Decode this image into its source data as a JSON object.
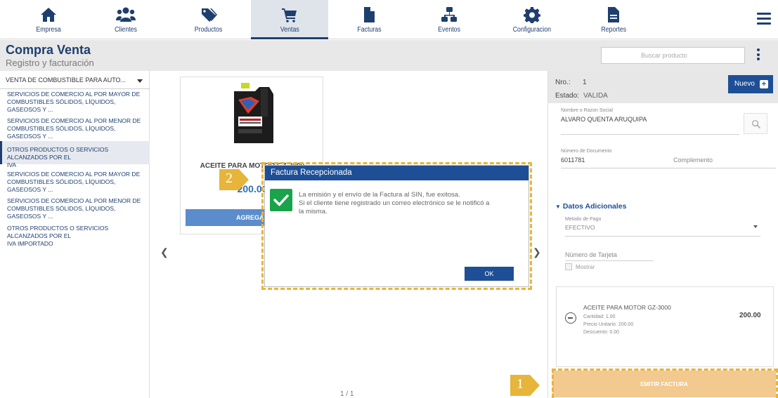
{
  "nav": {
    "items": [
      {
        "label": "Empresa",
        "icon": "home-icon"
      },
      {
        "label": "Clientes",
        "icon": "users-icon"
      },
      {
        "label": "Productos",
        "icon": "tag-icon"
      },
      {
        "label": "Ventas",
        "icon": "cart-icon",
        "active": true
      },
      {
        "label": "Facturas",
        "icon": "document-icon"
      },
      {
        "label": "Eventos",
        "icon": "network-icon"
      },
      {
        "label": "Configuracion",
        "icon": "gear-icon"
      },
      {
        "label": "Reportes",
        "icon": "report-icon"
      }
    ]
  },
  "header": {
    "title": "Compra Venta",
    "subtitle": "Registro y facturación",
    "search_placeholder": "Buscar producto"
  },
  "categories": {
    "selected_group": "VENTA DE COMBUSTIBLE PARA AUTO...",
    "items": [
      {
        "line1": "SERVICIOS DE COMERCIO AL POR MAYOR DE",
        "line2": "COMBUSTIBLES SÓLIDOS, LÍQUIDOS, GASEOSOS Y ..."
      },
      {
        "line1": "SERVICIOS DE COMERCIO AL POR MENOR DE",
        "line2": "COMBUSTIBLES SÓLIDOS, LÍQUIDOS, GASEOSOS Y ..."
      },
      {
        "line1": "OTROS PRODUCTOS O SERVICIOS ALCANZADOS POR EL",
        "line2": "IVA"
      },
      {
        "line1": "SERVICIOS DE COMERCIO AL POR MAYOR DE",
        "line2": "COMBUSTIBLES SÓLIDOS, LÍQUIDOS, GASEOSOS Y ..."
      },
      {
        "line1": "SERVICIOS DE COMERCIO AL POR MENOR DE",
        "line2": "COMBUSTIBLES SÓLIDOS, LÍQUIDOS, GASEOSOS Y ..."
      },
      {
        "line1": "OTROS PRODUCTOS O SERVICIOS ALCANZADOS POR EL",
        "line2": "IVA IMPORTADO"
      }
    ]
  },
  "product": {
    "name": "ACEITE PARA MOTOR GZ-3000",
    "price": "200.00",
    "add_label": "AGREGAR"
  },
  "pager": "1 / 1",
  "invoice": {
    "nro_label": "Nro.:",
    "nro_value": "1",
    "estado_label": "Estado:",
    "estado_value": "VALIDA",
    "nuevo_label": "Nuevo",
    "razon_label": "Nombre o Razon Social",
    "razon_value": "ALVARO QUENTA ARUQUIPA",
    "doc_label": "Número de Documento",
    "doc_value": "6011781",
    "complemento_placeholder": "Complemento",
    "datos_title": "Datos Adicionales",
    "metodo_label": "Metodo de Pago",
    "metodo_value": "EFECTIVO",
    "tarjeta_placeholder": "Número de Tarjeta",
    "mostrar_label": "Mostrar",
    "emitir_label": "EMITIR FACTURA"
  },
  "cart": {
    "name": "ACEITE PARA MOTOR GZ-3000",
    "cantidad": "Cantidad: 1.00",
    "precio": "Precio Unitario: 200.00",
    "descuento": "Descuento: 0.00",
    "total": "200.00"
  },
  "modal": {
    "title": "Factura Recepcionada",
    "line1": "La emisión y el envío de la Factura al SIN, fue exitosa.",
    "line2": "Si el cliente tiene registrado un correo electrónico se le notificó a",
    "line3": "la misma.",
    "ok_label": "OK"
  },
  "badges": {
    "step1": "1",
    "step2": "2"
  },
  "colors": {
    "primary": "#1e4f96",
    "nav": "#1e3f6e",
    "highlight": "#e6b53a",
    "success": "#1aa34a",
    "emit": "#f2c98f"
  }
}
